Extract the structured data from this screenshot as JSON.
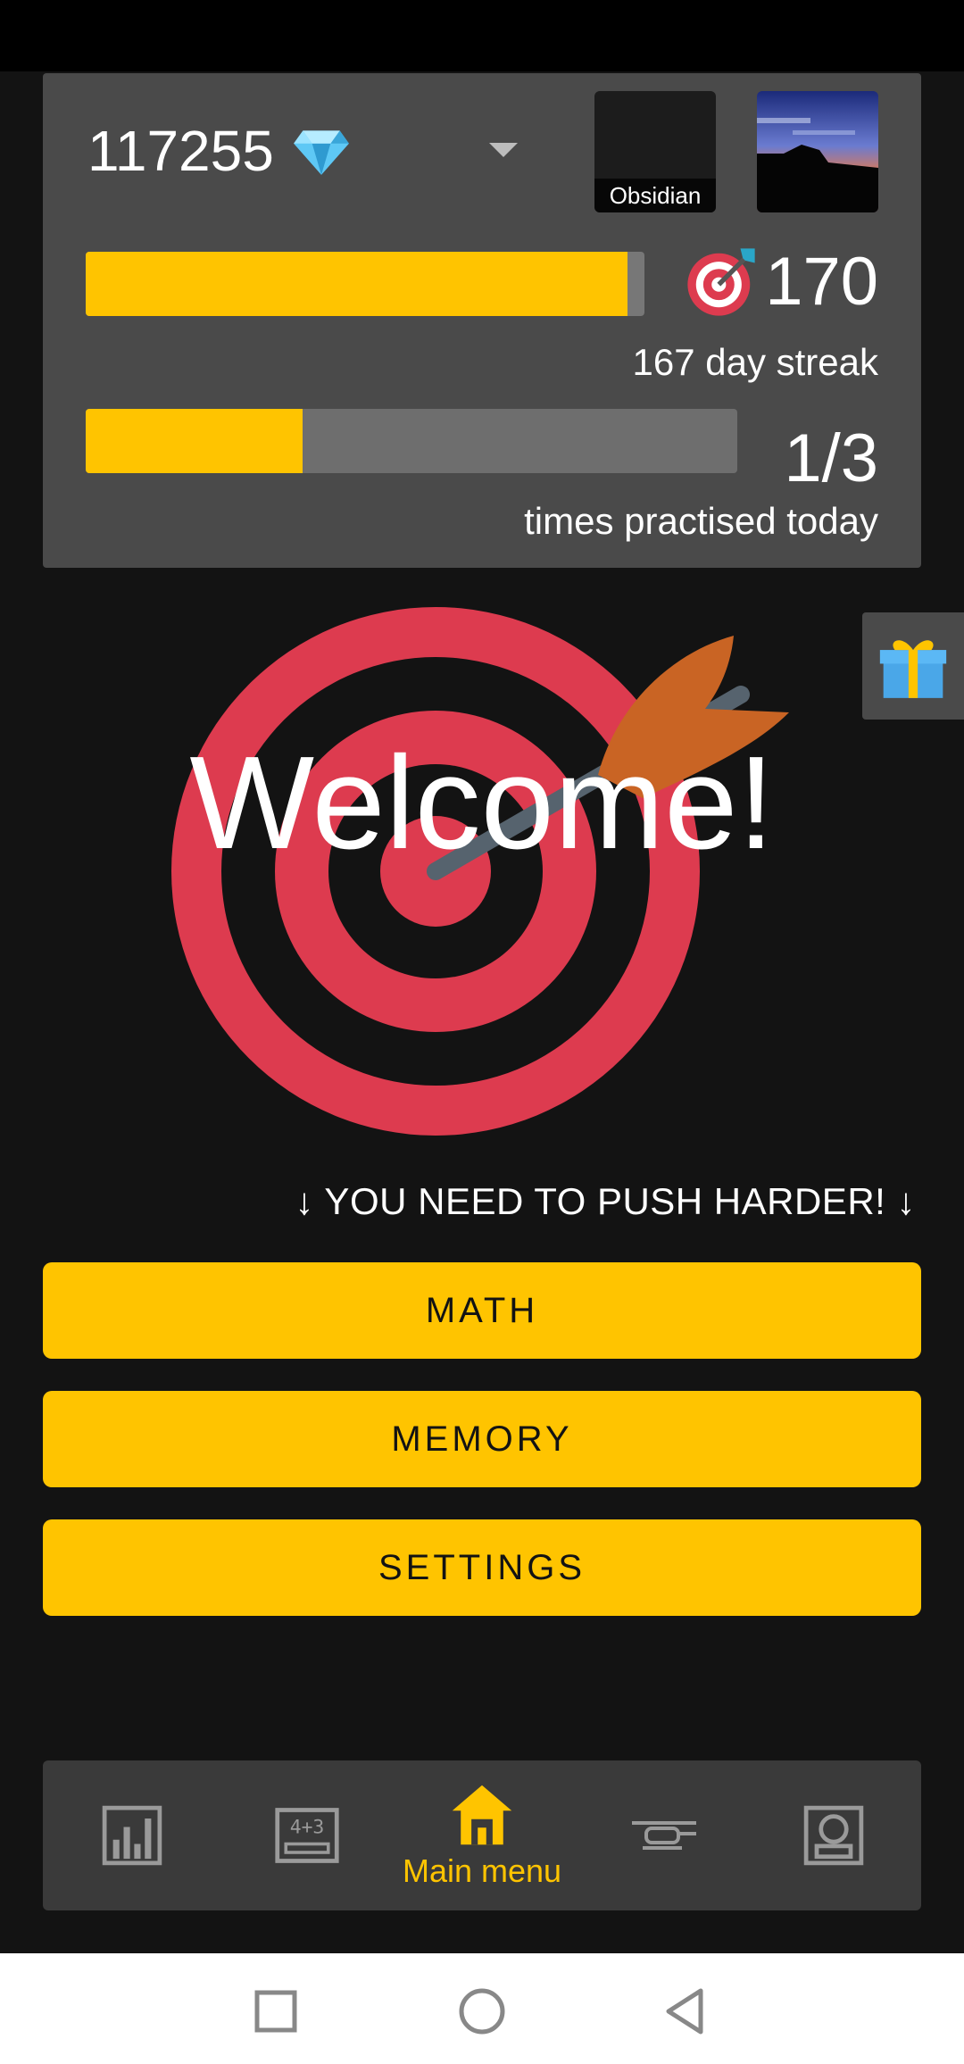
{
  "stats": {
    "gems": "117255",
    "theme_label": "Obsidian",
    "streak_value": "170",
    "streak_label": "167 day streak",
    "practice_value": "1/3",
    "practice_label": "times practised today",
    "streak_progress": 0.97,
    "practice_progress": 0.333
  },
  "hero": {
    "welcome": "Welcome!",
    "push_text": "↓ YOU NEED TO PUSH HARDER! ↓"
  },
  "menu": {
    "math": "MATH",
    "memory": "MEMORY",
    "settings": "SETTINGS"
  },
  "bottom_nav": {
    "active_label": "Main menu",
    "items": [
      "stats-icon",
      "calculator-icon",
      "home-icon",
      "helicopter-icon",
      "computer-icon"
    ]
  },
  "colors": {
    "accent": "#ffc400",
    "background": "#131313",
    "card": "#4a4a4a",
    "target_red": "#dd3b4f",
    "arrow_orange": "#c96424"
  }
}
